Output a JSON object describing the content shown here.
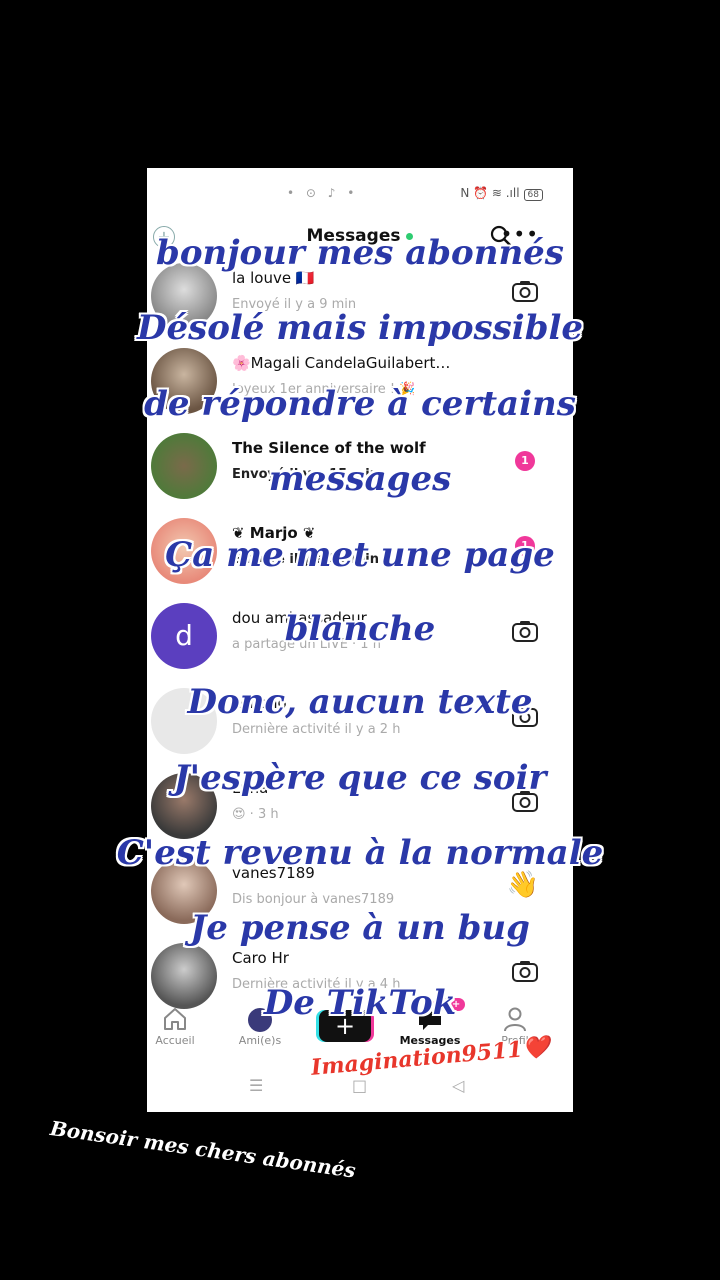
{
  "status_bar": {
    "left_icons": "• ⊙ ♪ •",
    "right_icons": "N ⏰ ≋ .ıll",
    "battery": "68"
  },
  "header": {
    "title": "Messages"
  },
  "conversations": [
    {
      "name": "la louve 🇫🇷",
      "sub": "Envoyé il y a 9 min",
      "action": "camera",
      "name_bold": false,
      "sub_bold": false
    },
    {
      "name": "🌸Magali CandelaGuilabert…",
      "sub": "Joyeux 1er anniversaire ! 🎉",
      "action": "",
      "name_bold": false,
      "sub_bold": false
    },
    {
      "name": "The Silence of the wolf",
      "sub": "Envoyé il y a 15 min",
      "action": "badge",
      "badge": "1",
      "name_bold": true,
      "sub_bold": true
    },
    {
      "name": "❦ Marjo ❦",
      "sub": "Envoyé il y a 25 min",
      "action": "badge",
      "badge": "1",
      "name_bold": true,
      "sub_bold": true
    },
    {
      "name": "dou ambassadeur",
      "sub": "a partagé un LIVE · 1 h",
      "action": "camera",
      "avatar_letter": "d",
      "name_bold": false,
      "sub_bold": false
    },
    {
      "name": "Lenono",
      "sub": "Dernière activité il y a 2 h",
      "action": "camera",
      "name_bold": false,
      "sub_bold": false
    },
    {
      "name": "Luna",
      "sub": "😍 · 3 h",
      "action": "camera",
      "name_bold": false,
      "sub_bold": false
    },
    {
      "name": "vanes7189",
      "sub": "Dis bonjour à vanes7189",
      "action": "wave",
      "name_bold": false,
      "sub_bold": false
    },
    {
      "name": "Caro Hr",
      "sub": "Dernière activité il y a 4 h",
      "action": "camera",
      "name_bold": false,
      "sub_bold": false
    }
  ],
  "tabbar": {
    "home": "Accueil",
    "friends": "Ami(e)s",
    "create": "+",
    "messages": "Messages",
    "messages_badge": "99+",
    "profile": "Profil"
  },
  "navbar": {
    "menu": "☰",
    "home": "□",
    "back": "◁"
  },
  "overlay_lines": [
    "bonjour mes abonnés",
    "Désolé mais impossible",
    "de répondre à certains",
    "messages",
    "Ça me met une page",
    "blanche",
    "Donc, aucun texte",
    "J'espère que ce soir",
    "C'est revenu à la normale",
    "Je pense à un bug",
    "De TikTok"
  ],
  "signature": "Imagination9511❤️",
  "caption": "Bonsoir mes chers abonnés"
}
